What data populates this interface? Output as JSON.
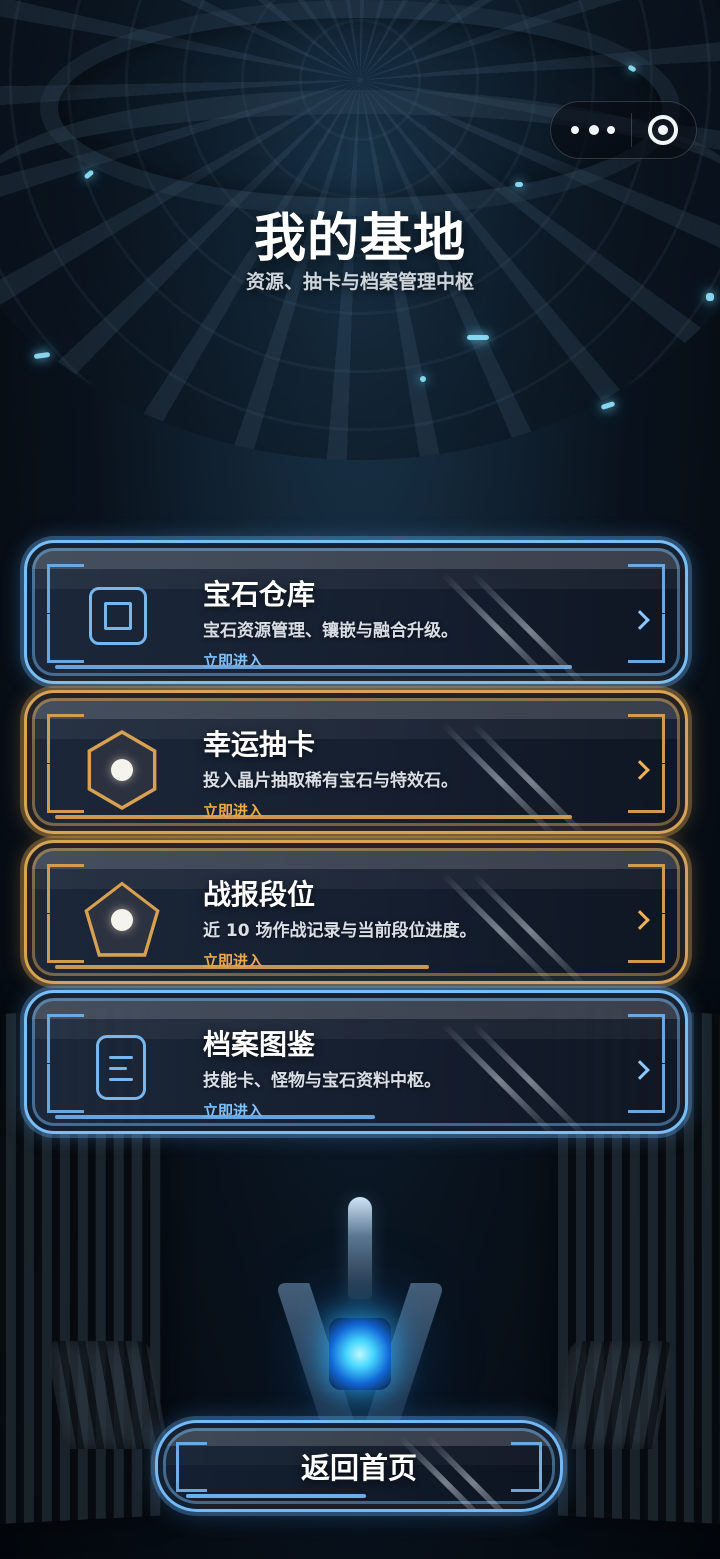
{
  "header": {
    "title": "我的基地",
    "subtitle": "资源、抽卡与档案管理中枢"
  },
  "capsule": {
    "more_icon": "more-dots-icon",
    "target_icon": "target-icon"
  },
  "cards": [
    {
      "title": "宝石仓库",
      "description": "宝石资源管理、镶嵌与融合升级。",
      "action": "立即进入",
      "theme": "blue",
      "icon": "square-gem-icon",
      "progress_fraction": 0.76
    },
    {
      "title": "幸运抽卡",
      "description": "投入晶片抽取稀有宝石与特效石。",
      "action": "立即进入",
      "theme": "gold",
      "icon": "hexagon-orb-icon",
      "progress_fraction": 0.76
    },
    {
      "title": "战报段位",
      "description": "近 10 场作战记录与当前段位进度。",
      "action": "立即进入",
      "theme": "gold",
      "icon": "pentagon-orb-icon",
      "progress_fraction": 0.55
    },
    {
      "title": "档案图鉴",
      "description": "技能卡、怪物与宝石资料中枢。",
      "action": "立即进入",
      "theme": "blue",
      "icon": "document-icon",
      "progress_fraction": 0.47
    }
  ],
  "footer": {
    "return_label": "返回首页"
  },
  "colors": {
    "blue_accent": "#70aee8",
    "gold_accent": "#d9a253",
    "background_dark": "#07101a"
  }
}
